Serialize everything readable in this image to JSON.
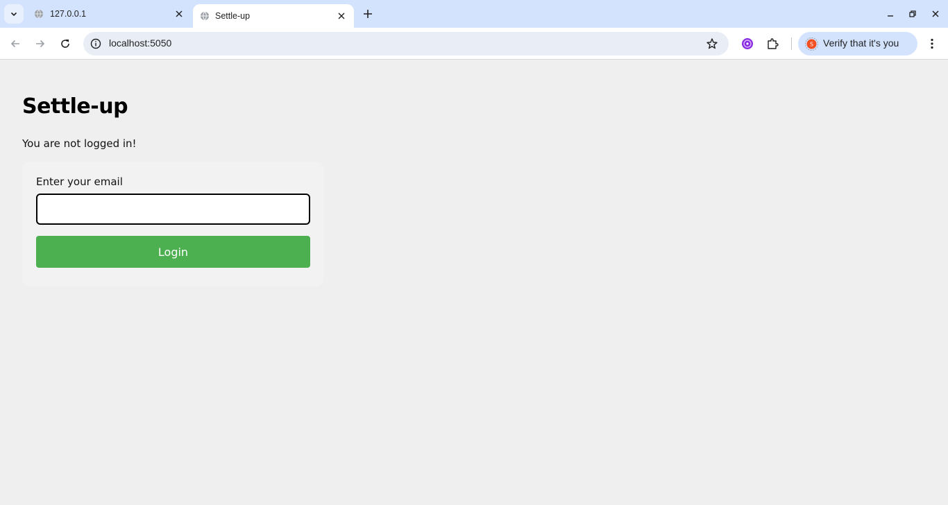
{
  "browser": {
    "tabs": [
      {
        "title": "127.0.0.1",
        "active": false,
        "favicon": "globe-icon"
      },
      {
        "title": "Settle-up",
        "active": true,
        "favicon": "globe-icon"
      }
    ],
    "url": "localhost:5050",
    "profile_chip_label": "Verify that it's you",
    "profile_avatar_letter": "S",
    "accent_color": "#d3e3fd"
  },
  "page": {
    "title": "Settle-up",
    "status": "You are not logged in!",
    "form": {
      "email_label": "Enter your email",
      "email_value": "",
      "email_placeholder": "",
      "login_label": "Login"
    },
    "colors": {
      "login_button": "#4caf50",
      "background": "#efefef"
    }
  }
}
